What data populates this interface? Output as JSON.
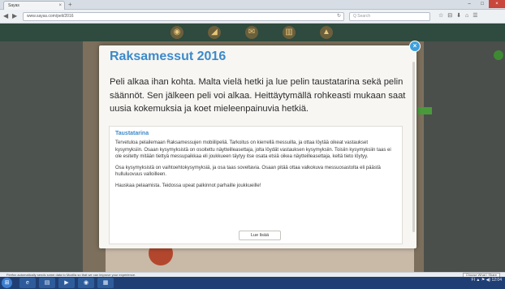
{
  "browser": {
    "tab_title": "Sayas",
    "tab_close": "×",
    "new_tab": "+",
    "url": "www.sayas.com/peli/2016",
    "search_placeholder": "Q Search",
    "window_controls": [
      "–",
      "□",
      "×"
    ],
    "toolbar_icons": [
      "☆",
      "⊟",
      "⬇",
      "⌂",
      "☰"
    ]
  },
  "site": {
    "header_icons": [
      "◉",
      "◢",
      "✉",
      "▥",
      "▲"
    ]
  },
  "modal": {
    "title": "Raksamessut 2016",
    "lead": "Peli alkaa ihan kohta. Malta vielä hetki ja lue pelin taustatarina sekä pelin säännöt. Sen jälkeen peli voi alkaa. Heittäytymällä rohkeasti mukaan saat uusia kokemuksia ja koet mieleenpainuvia hetkiä.",
    "story": {
      "heading": "Taustatarina",
      "paragraphs": [
        "Tervetuloa pelailemaan Raksamessujen mobiilipeliä. Tarkoitus on kierrellä messuilla, ja ottaa löytää oikeat vastaukset kysymyksiin. Osaan kysymyksistä on osoitettu näytteilleasettaja, jolta löydät vastauksen kysymyksiin. Toisiin kysymyksiin taas ei ole esitetty mitään tiettyä messupaikkaa eli joukkueen täytyy itse osata etsiä oikea näytteilleasettaja, keltä tieto löytyy.",
        "Osa kysymyksistä on vaihtoehtokysymyksiä, ja osa taas soveltavia. Osaan pitää ottaa valkokuva messuosastolta eli päästä hulluluovuus valloilleen.",
        "Hauskaa pelaamista. Teidossa upeat palkinnot parhaille joukkueille!"
      ]
    },
    "more_button": "Lue lisää",
    "close": "×"
  },
  "notification": {
    "text": "Firefox automatically sends some data to Mozilla so that we can improve your experience.",
    "button": "Choose What I Share"
  },
  "taskbar": {
    "start": "⊞",
    "apps": [
      "e",
      "▤",
      "▶",
      "◉",
      "▦"
    ],
    "tray_text": "FI  ▲  ⚑  ◀)  12:04"
  }
}
